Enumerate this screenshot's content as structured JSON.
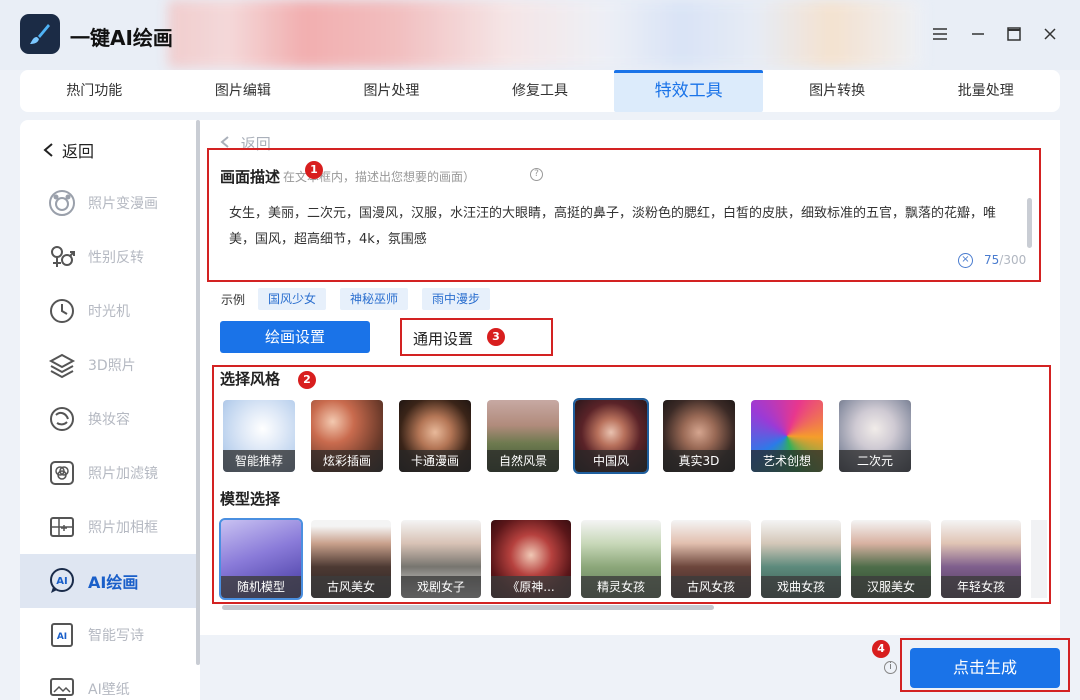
{
  "app": {
    "title": "一键AI绘画"
  },
  "window_controls": [
    "menu-icon",
    "minimize-icon",
    "maximize-icon",
    "close-icon"
  ],
  "tabs": [
    {
      "label": "热门功能",
      "active": false
    },
    {
      "label": "图片编辑",
      "active": false
    },
    {
      "label": "图片处理",
      "active": false
    },
    {
      "label": "修复工具",
      "active": false
    },
    {
      "label": "特效工具",
      "active": true
    },
    {
      "label": "图片转换",
      "active": false
    },
    {
      "label": "批量处理",
      "active": false
    }
  ],
  "sidebar": {
    "back_label": "返回",
    "items": [
      {
        "label": "照片变漫画",
        "icon": "cartoon-face-icon",
        "active": false
      },
      {
        "label": "性别反转",
        "icon": "gender-icon",
        "active": false
      },
      {
        "label": "时光机",
        "icon": "clock-icon",
        "active": false
      },
      {
        "label": "3D照片",
        "icon": "layers-icon",
        "active": false
      },
      {
        "label": "换妆容",
        "icon": "makeup-icon",
        "active": false
      },
      {
        "label": "照片加滤镜",
        "icon": "filter-icon",
        "active": false
      },
      {
        "label": "照片加相框",
        "icon": "frame-icon",
        "active": false
      },
      {
        "label": "AI绘画",
        "icon": "ai-paint-icon",
        "active": true
      },
      {
        "label": "智能写诗",
        "icon": "ai-poem-icon",
        "active": false
      },
      {
        "label": "AI壁纸",
        "icon": "wallpaper-icon",
        "active": false
      }
    ]
  },
  "main": {
    "back_label": "返回",
    "description": {
      "title": "画面描述",
      "hint": "在文本框内，描述出您想要的画面）",
      "text": "女生，美丽，二次元，国漫风，汉服，水汪汪的大眼睛，高挺的鼻子，淡粉色的腮红，白皙的皮肤，细致标准的五官，飘落的花瓣，唯美，国风，超高细节，4k，氛围感",
      "count": "75",
      "max": "/300"
    },
    "examples": {
      "label": "示例",
      "chips": [
        "国风少女",
        "神秘巫师",
        "雨中漫步"
      ]
    },
    "settings": {
      "draw_label": "绘画设置",
      "general_label": "通用设置"
    },
    "style": {
      "title": "选择风格",
      "items": [
        {
          "label": "智能推荐",
          "selected": false
        },
        {
          "label": "炫彩插画",
          "selected": false
        },
        {
          "label": "卡通漫画",
          "selected": false
        },
        {
          "label": "自然风景",
          "selected": false
        },
        {
          "label": "中国风",
          "selected": true
        },
        {
          "label": "真实3D",
          "selected": false
        },
        {
          "label": "艺术创想",
          "selected": false
        },
        {
          "label": "二次元",
          "selected": false
        }
      ]
    },
    "model": {
      "title": "模型选择",
      "items": [
        {
          "label": "随机模型",
          "selected": true
        },
        {
          "label": "古风美女",
          "selected": false
        },
        {
          "label": "戏剧女子",
          "selected": false
        },
        {
          "label": "《原神...",
          "selected": false
        },
        {
          "label": "精灵女孩",
          "selected": false
        },
        {
          "label": "古风女孩",
          "selected": false
        },
        {
          "label": "戏曲女孩",
          "selected": false
        },
        {
          "label": "汉服美女",
          "selected": false
        },
        {
          "label": "年轻女孩",
          "selected": false
        }
      ]
    },
    "generate_label": "点击生成"
  },
  "annotations": [
    "1",
    "2",
    "3",
    "4"
  ],
  "colors": {
    "accent": "#1a73e8",
    "annotation": "#d32222"
  }
}
